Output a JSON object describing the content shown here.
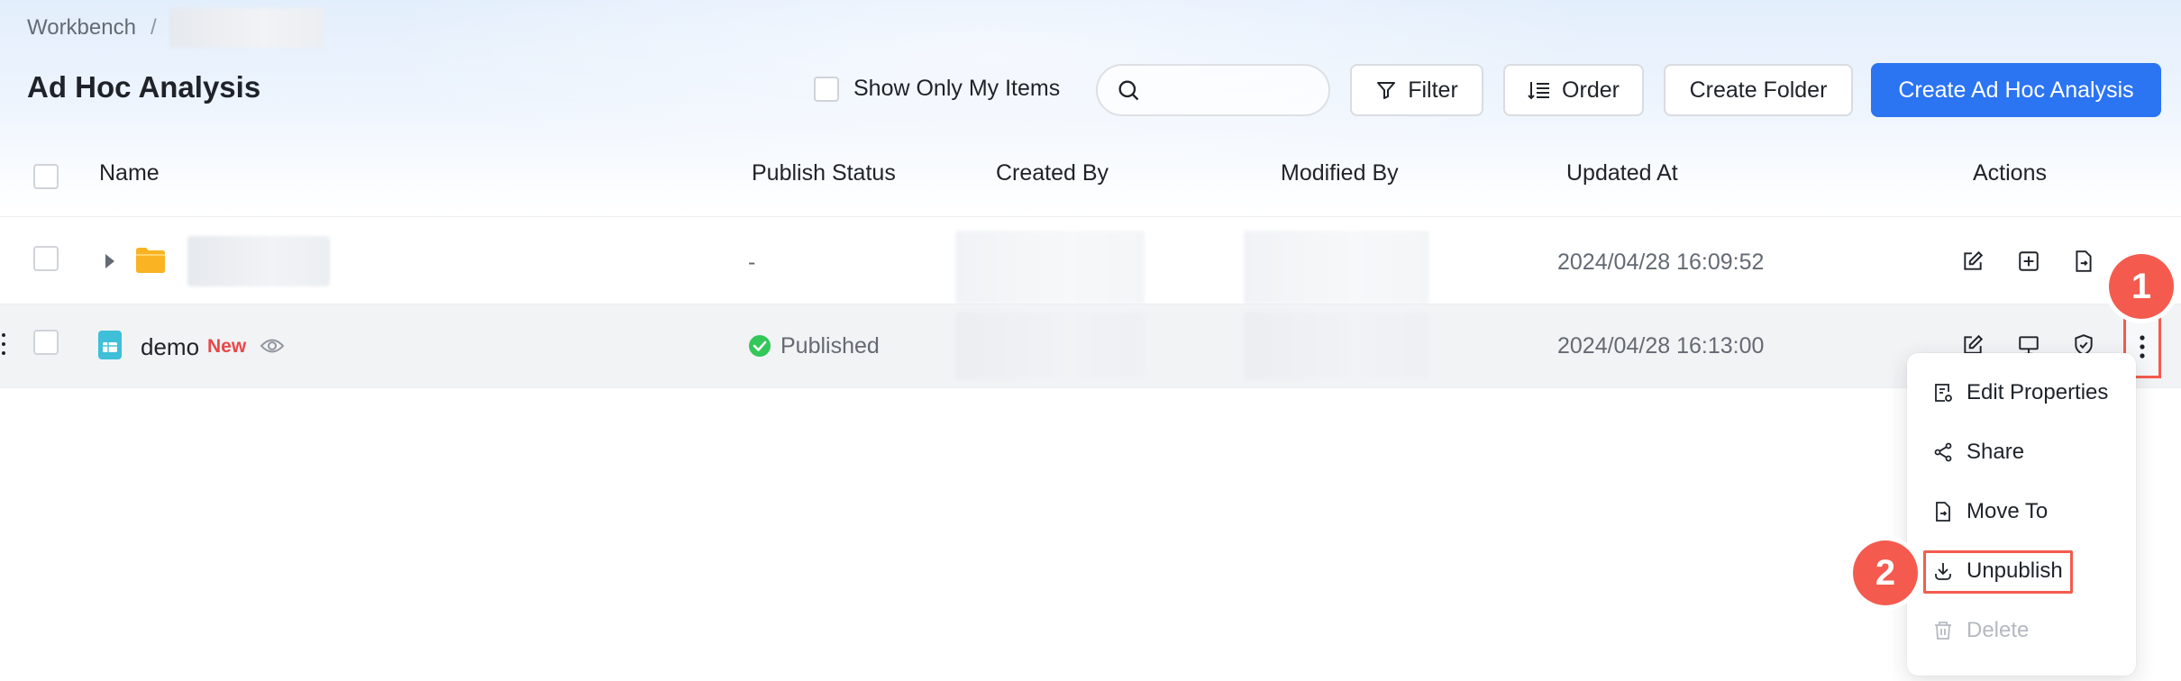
{
  "breadcrumb": {
    "root": "Workbench",
    "separator": "/"
  },
  "page": {
    "title": "Ad Hoc Analysis"
  },
  "toolbar": {
    "show_only_mine": "Show Only My Items",
    "search_placeholder": "",
    "filter": "Filter",
    "order": "Order",
    "create_folder": "Create Folder",
    "create_analysis": "Create Ad Hoc Analysis"
  },
  "table": {
    "columns": {
      "name": "Name",
      "publish_status": "Publish Status",
      "created_by": "Created By",
      "modified_by": "Modified By",
      "updated_at": "Updated At",
      "actions": "Actions"
    },
    "rows": [
      {
        "type": "folder",
        "name": "",
        "publish_status": "-",
        "updated_at": "2024/04/28 16:09:52"
      },
      {
        "type": "analysis",
        "name": "demo",
        "badge": "New",
        "publish_status": "Published",
        "updated_at": "2024/04/28 16:13:00"
      }
    ]
  },
  "menu": {
    "items": [
      {
        "label": "Edit Properties",
        "icon": "edit-properties-icon"
      },
      {
        "label": "Share",
        "icon": "share-icon"
      },
      {
        "label": "Move To",
        "icon": "move-to-icon"
      },
      {
        "label": "Unpublish",
        "icon": "unpublish-icon"
      },
      {
        "label": "Delete",
        "icon": "delete-icon",
        "disabled": true
      }
    ]
  },
  "markers": {
    "step1": "1",
    "step2": "2"
  },
  "colors": {
    "primary": "#2b74f2",
    "accent_red": "#f45b4e",
    "success": "#34c759",
    "folder": "#f9b323",
    "doc": "#3fbfd8"
  }
}
